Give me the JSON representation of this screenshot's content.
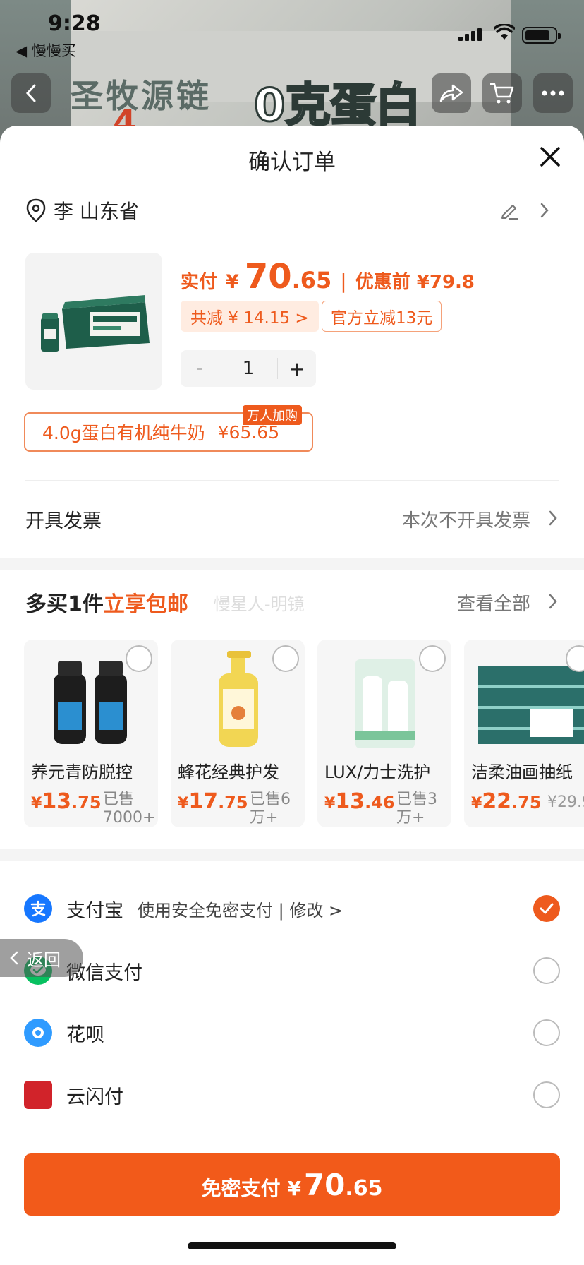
{
  "status_bar": {
    "time": "9:28",
    "back_app": "◀ 慢慢买"
  },
  "background": {
    "banner_text_1": "圣牧源链",
    "banner_text_2": "0克蛋白",
    "banner_text_3": "4"
  },
  "sheet": {
    "title": "确认订单",
    "address": {
      "text": "李 山东省"
    },
    "product": {
      "pay_label": "实付",
      "yen": "¥",
      "price_int": "70",
      "price_dec": ".65",
      "separator": "|",
      "before_label": "优惠前 ¥79.8",
      "save_tag": "共减 ¥ 14.15 >",
      "official_tag": "官方立减13元",
      "quantity": "1",
      "minus": "-",
      "plus": "+"
    },
    "variant": {
      "name": "4.0g蛋白有机纯牛奶",
      "price": "¥65.65",
      "badge": "万人加购"
    },
    "invoice": {
      "label": "开具发票",
      "value": "本次不开具发票"
    },
    "more_buy": {
      "title_a": "多买1件",
      "title_b": "立享包邮",
      "watermark": "慢星人-明镜",
      "view_all": "查看全部",
      "items": [
        {
          "name": "养元青防脱控",
          "yen": "¥",
          "int": "13",
          "dec": ".75",
          "sold": "已售7000+"
        },
        {
          "name": "蜂花经典护发",
          "yen": "¥",
          "int": "17",
          "dec": ".75",
          "sold": "已售6万+"
        },
        {
          "name": "LUX/力士洗护",
          "yen": "¥",
          "int": "13",
          "dec": ".46",
          "sold": "已售3万+"
        },
        {
          "name": "洁柔油画抽纸",
          "yen": "¥",
          "int": "22",
          "dec": ".75",
          "sold": "¥29.9"
        }
      ]
    },
    "payment": {
      "alipay": {
        "name": "支付宝",
        "sub": "使用安全免密支付 | 修改 >"
      },
      "wechat": {
        "name": "微信支付"
      },
      "huabei": {
        "name": "花呗"
      },
      "unionpay": {
        "name": "云闪付"
      }
    },
    "float_back": "返回",
    "pay_button": {
      "label": "免密支付",
      "yen": "¥",
      "int": "70",
      "dec": ".65"
    }
  },
  "colors": {
    "accent": "#ee5a1d",
    "button": "#f25a1a",
    "alipay": "#1677ff",
    "wechat": "#07c160",
    "huabei": "#2f9bff",
    "unionpay": "#d1232a"
  }
}
